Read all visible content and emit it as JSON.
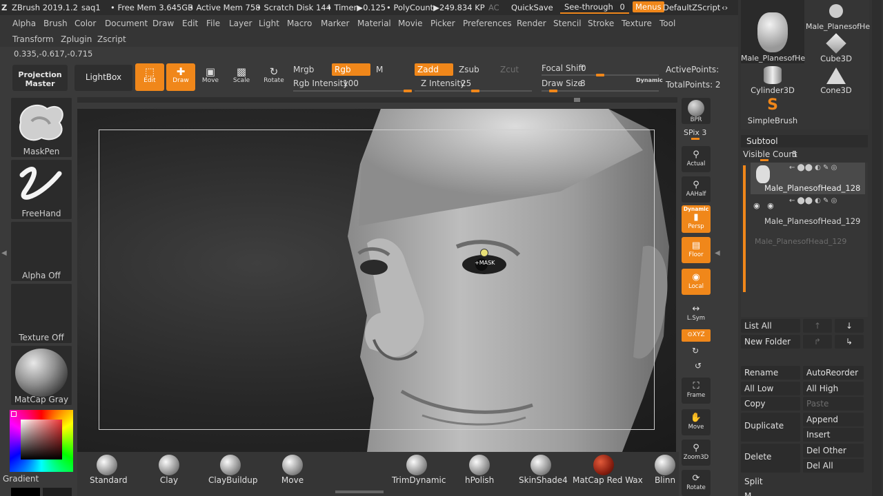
{
  "titlebar": {
    "app": "ZBrush 2019.1.2",
    "doc": "saq1",
    "free_mem": "• Free Mem 3.645GB",
    "active_mem": "• Active Mem 758",
    "scratch": "• Scratch Disk 144",
    "timer": "• Timer▶0.125",
    "polycount": "• PolyCount▶249.834 KP",
    "ac": "AC",
    "quicksave": "QuickSave",
    "see_through": "See-through",
    "see_through_value": "0",
    "menus": "Menus",
    "script": "DefaultZScript"
  },
  "menu_row1": [
    "Alpha",
    "Brush",
    "Color",
    "Document",
    "Draw",
    "Edit",
    "File",
    "Layer",
    "Light",
    "Macro",
    "Marker",
    "Material",
    "Movie",
    "Picker",
    "Preferences",
    "Render",
    "Stencil",
    "Stroke",
    "Texture",
    "Tool"
  ],
  "menu_row2": [
    "Transform",
    "Zplugin",
    "Zscript"
  ],
  "coords": "0.335,-0.617,-0.715",
  "toolbar": {
    "projection_master": "Projection Master",
    "lightbox": "LightBox",
    "edit": "Edit",
    "draw": "Draw",
    "move": "Move",
    "scale": "Scale",
    "rotate": "Rotate",
    "mrgb": "Mrgb",
    "rgb": "Rgb",
    "m": "M",
    "zadd": "Zadd",
    "zsub": "Zsub",
    "zcut": "Zcut",
    "rgb_intensity_label": "Rgb Intensity",
    "rgb_intensity": "100",
    "z_intensity_label": "Z Intensity",
    "z_intensity": "25",
    "focal_shift_label": "Focal Shift",
    "focal_shift": "0",
    "draw_size_label": "Draw Size",
    "draw_size": "8",
    "dynamic": "Dynamic",
    "active_points": "ActivePoints:",
    "total_points": "TotalPoints: 2"
  },
  "left_shelf": {
    "brush": "MaskPen",
    "stroke": "FreeHand",
    "alpha": "Alpha Off",
    "texture": "Texture Off",
    "material": "MatCap Gray",
    "gradient": "Gradient"
  },
  "viewport": {
    "cursor_label": "+MASK"
  },
  "right_shelf": {
    "bpr": "BPR",
    "spix": "SPix 3",
    "actual": "Actual",
    "aahalf": "AAHalf",
    "dynamic": "Dynamic",
    "persp": "Persp",
    "floor": "Floor",
    "local": "Local",
    "lsym": "L.Sym",
    "xyz": "⊙XYZ",
    "frame": "Frame",
    "move": "Move",
    "zoom3d": "Zoom3D",
    "rotate": "Rotate"
  },
  "brushes": [
    "Standard",
    "Clay",
    "ClayBuildup",
    "Move",
    "TrimDynamic",
    "hPolish",
    "SkinShade4",
    "MatCap Red Wax",
    "Blinn"
  ],
  "tool_palette": {
    "items": [
      "Male_PlanesofHe",
      "Male_PlanesofHe",
      "Cube3D",
      "Cylinder3D",
      "Cone3D",
      "SimpleBrush"
    ]
  },
  "subtool": {
    "title": "Subtool",
    "visible_count_label": "Visible Count",
    "visible_count": "5",
    "rows": [
      "Male_PlanesofHead_128",
      "Male_PlanesofHead_129",
      "Male_PlanesofHead_129"
    ],
    "list_all": "List All",
    "new_folder": "New Folder",
    "rename": "Rename",
    "autoreorder": "AutoReorder",
    "all_low": "All Low",
    "all_high": "All High",
    "copy": "Copy",
    "paste": "Paste",
    "duplicate": "Duplicate",
    "append": "Append",
    "insert": "Insert",
    "delete": "Delete",
    "del_other": "Del Other",
    "del_all": "Del All",
    "split": "Split",
    "next": "M..."
  },
  "colors": {
    "accent": "#f0871a",
    "panel": "#333333",
    "viewport": "#262626"
  }
}
